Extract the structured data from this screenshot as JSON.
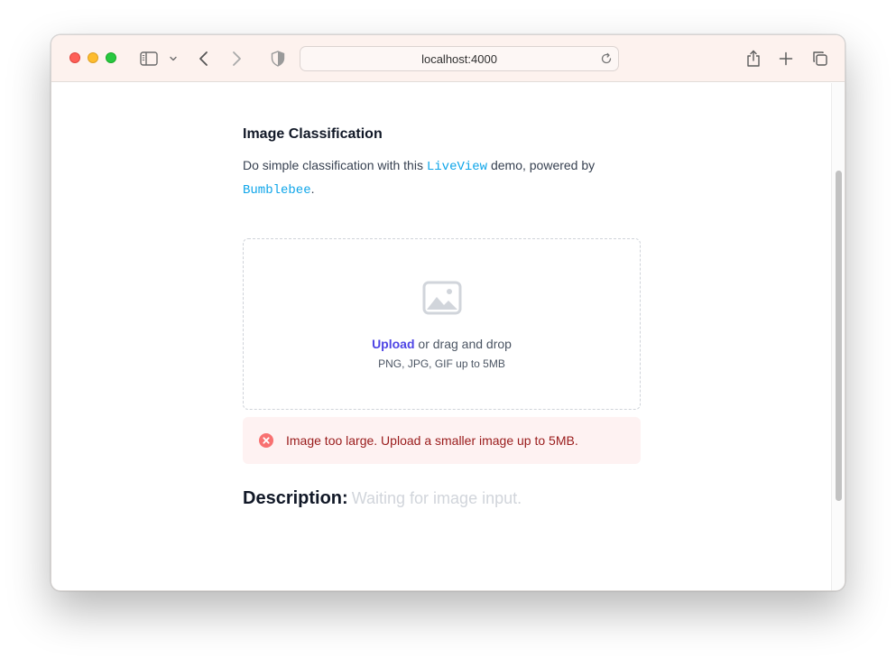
{
  "browser": {
    "address": "localhost:4000"
  },
  "page": {
    "title": "Image Classification",
    "intro": {
      "prefix": "Do simple classification with this ",
      "liveview": "LiveView",
      "middle": " demo, powered by",
      "bumblebee": "Bumblebee",
      "suffix": "."
    },
    "dropzone": {
      "upload_link": "Upload",
      "upload_rest": " or drag and drop",
      "hint": "PNG, JPG, GIF up to 5MB"
    },
    "error": {
      "message": "Image too large. Upload a smaller image up to 5MB."
    },
    "description": {
      "label": "Description:",
      "value": "Waiting for image input."
    }
  },
  "colors": {
    "accent": "#4f46e5",
    "code": "#0ea5e9",
    "error_bg": "#fef2f2",
    "error_text": "#991b1b",
    "error_icon": "#f87171"
  }
}
